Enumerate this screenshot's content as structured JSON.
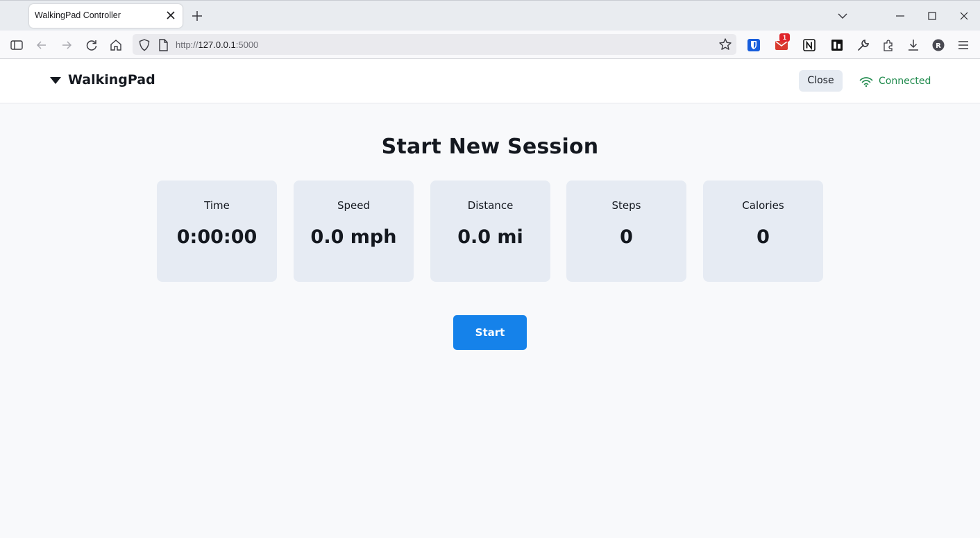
{
  "browser": {
    "tab_title": "WalkingPad Controller",
    "url_scheme": "http://",
    "url_host": "127.0.0.1",
    "url_port": ":5000",
    "notification_count": "1",
    "profile_initial": "R"
  },
  "header": {
    "brand": "WalkingPad",
    "close_label": "Close",
    "status": "Connected",
    "status_color": "#1f8a4c"
  },
  "main": {
    "title": "Start New Session",
    "stats": [
      {
        "label": "Time",
        "value": "0:00:00"
      },
      {
        "label": "Speed",
        "value": "0.0 mph"
      },
      {
        "label": "Distance",
        "value": "0.0 mi"
      },
      {
        "label": "Steps",
        "value": "0"
      },
      {
        "label": "Calories",
        "value": "0"
      }
    ],
    "start_label": "Start",
    "accent": "#1582ea"
  },
  "icons": {
    "tabbar": [
      "new-tab-icon",
      "list-all-tabs-icon",
      "minimize-icon",
      "maximize-icon",
      "close-window-icon"
    ],
    "nav": [
      "sidebar-icon",
      "back-icon",
      "forward-icon",
      "reload-icon",
      "home-icon",
      "shield-icon",
      "page-icon",
      "bookmark-star-icon"
    ],
    "extensions": [
      "bitwarden-icon",
      "mail-icon",
      "notion-icon",
      "reader-icon",
      "wrench-icon",
      "extensions-icon",
      "downloads-icon",
      "profile-icon",
      "menu-icon"
    ]
  }
}
